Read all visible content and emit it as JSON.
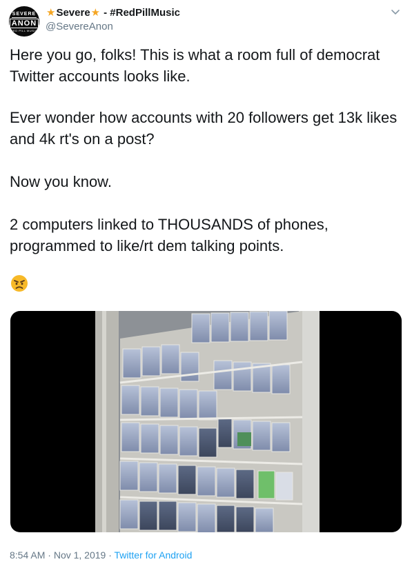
{
  "author": {
    "display_name": "Severe",
    "name_suffix": "- #RedPillMusic",
    "handle": "@SevereAnon",
    "avatar_text": {
      "top": "SEVERE",
      "middle": "ANON",
      "bottom": "RED PILL MUSIC"
    }
  },
  "tweet": {
    "paragraphs": [
      "Here you go, folks! This is what a room full of democrat Twitter accounts looks like.",
      "Ever wonder how accounts with 20 followers get 13k likes and 4k rt's on a post?",
      "Now you know.",
      "2 computers linked to THOUSANDS of phones, programmed to like/rt dem talking points."
    ],
    "emoji": "angry-face",
    "media": {
      "type": "video",
      "subject": "racks-of-phones"
    }
  },
  "footer": {
    "time": "8:54 AM",
    "separator": "·",
    "date": "Nov 1, 2019",
    "source": "Twitter for Android"
  },
  "colors": {
    "text": "#14171a",
    "secondary": "#657786",
    "link": "#1da1f2",
    "star": "#f5a623",
    "emoji": "#f4b400"
  }
}
